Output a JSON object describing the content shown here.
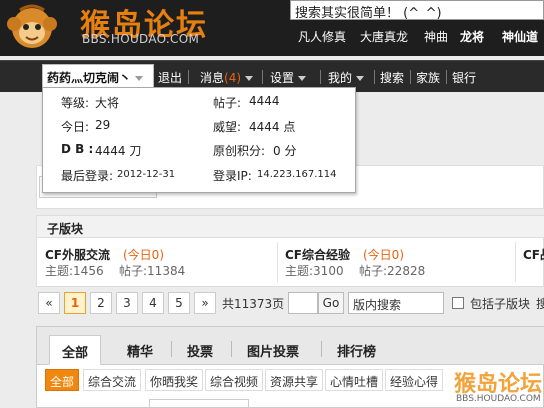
{
  "header": {
    "logo_text": "猴岛论坛",
    "logo_url": "BBS.HOUDAO.COM",
    "search_text": "搜索其实很简单！ (^_^)",
    "nav": [
      "凡人修真",
      "大唐真龙",
      "神曲",
      "龙将",
      "神仙道"
    ]
  },
  "userbar": {
    "username": "药药灬切克闹丶",
    "logout": "退出",
    "messages": "消息",
    "message_count": "(4)",
    "settings": "设置",
    "mine": "我的",
    "search": "搜索",
    "family": "家族",
    "bank": "银行"
  },
  "popup": {
    "level_label": "等级:",
    "level_value": "大将",
    "posts_label": "帖子:",
    "posts_value": "4444",
    "today_label": "今日:",
    "today_value": "29",
    "prestige_label": "威望:",
    "prestige_value": "4444 点",
    "db_label": "D B :",
    "db_value": "4444 刀",
    "original_label": "原创积分:",
    "original_value": "0 分",
    "last_login_label": "最后登录:",
    "last_login_value": "2012-12-31",
    "ip_label": "登录IP:",
    "ip_value": "14.223.167.114"
  },
  "subforums": {
    "heading": "子版块",
    "items": [
      {
        "name": "CF外服交流",
        "today": "(今日0)",
        "topics": "主题:1456",
        "posts": "帖子:11384"
      },
      {
        "name": "CF综合经验",
        "today": "(今日0)",
        "topics": "主题:3100",
        "posts": "帖子:22828"
      },
      {
        "name": "CF战"
      }
    ]
  },
  "pager": {
    "prev": "«",
    "pages": [
      "1",
      "2",
      "3",
      "4",
      "5"
    ],
    "next": "»",
    "total": "共11373页",
    "go": "Go",
    "search_placeholder": "版内搜索",
    "include_sub": "包括子版块",
    "trailing": "搜"
  },
  "tabs": {
    "items": [
      "全部",
      "精华",
      "投票",
      "图片投票",
      "排行榜"
    ]
  },
  "categories": [
    "全部",
    "综合交流",
    "你晒我奖",
    "综合视频",
    "资源共享",
    "心情吐槽",
    "经验心得"
  ],
  "watermark": {
    "text": "猴岛论坛",
    "url": "BBS.HOUDAO.COM"
  },
  "colors": {
    "accent": "#e8800e",
    "header_bg": "#1e1e1e",
    "active_cat": "#f0870f"
  }
}
